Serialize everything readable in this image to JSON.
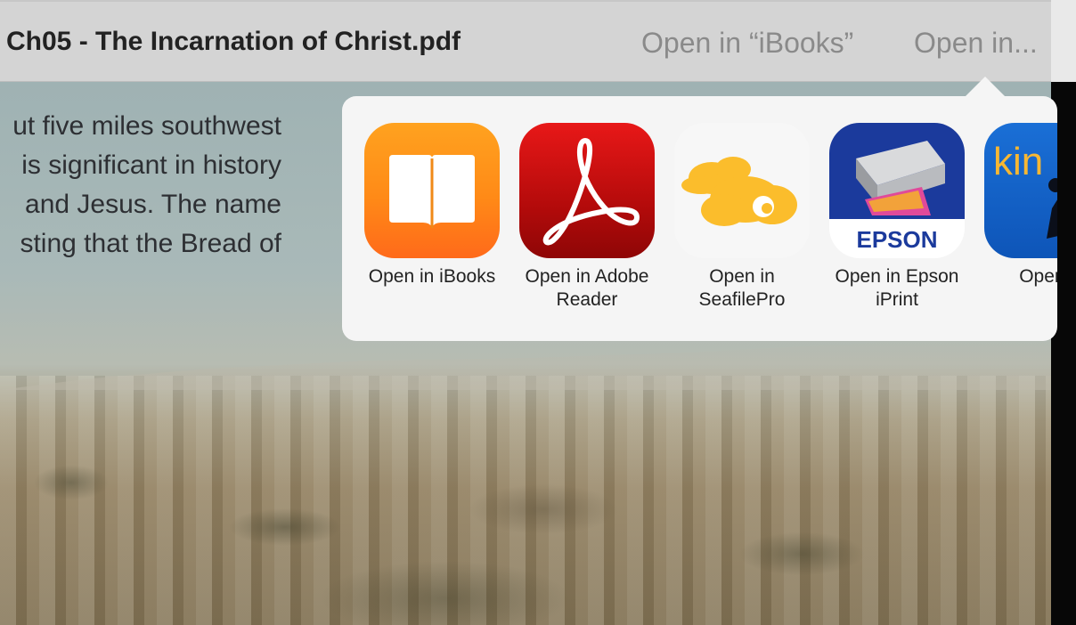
{
  "header": {
    "title": "Ch05 - The Incarnation of Christ.pdf",
    "open_in_ibooks": "Open in “iBooks”",
    "open_in": "Open in..."
  },
  "document": {
    "lines": [
      "ut five miles southwest",
      "is significant in history",
      "and Jesus. The name",
      "sting that the Bread of"
    ]
  },
  "share_sheet": {
    "apps": [
      {
        "name": "ibooks",
        "label_line1": "Open in iBooks",
        "label_line2": ""
      },
      {
        "name": "adobe-reader",
        "label_line1": "Open in Adobe",
        "label_line2": "Reader"
      },
      {
        "name": "seafilepro",
        "label_line1": "Open in",
        "label_line2": "SeafilePro"
      },
      {
        "name": "epson-iprint",
        "label_line1": "Open in Epson",
        "label_line2": "iPrint",
        "icon_text": "EPSON"
      },
      {
        "name": "kindle",
        "label_line1": "Open in",
        "label_line2": "",
        "icon_text": "kin"
      }
    ]
  },
  "colors": {
    "ibooks": "#ff8a17",
    "adobe": "#c40e0e",
    "seafile": "#fbbd2c",
    "epson_blue": "#1b3a9c",
    "kindle_blue": "#0e55b8"
  }
}
